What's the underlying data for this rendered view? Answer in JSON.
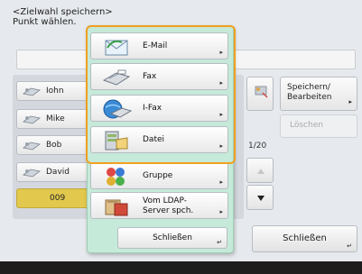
{
  "header": {
    "line1": "<Zielwahl speichern>",
    "line2": "Punkt wählen."
  },
  "addresses": [
    {
      "label": "Iohn"
    },
    {
      "label": "Mike"
    },
    {
      "label": "Bob"
    },
    {
      "label": "David"
    },
    {
      "label": "009"
    }
  ],
  "page_indicator": "1/20",
  "right_buttons": {
    "store": "Speichern/\nBearbeiten",
    "store_line1": "Speichern/",
    "store_line2": "Bearbeiten",
    "delete": "Löschen"
  },
  "main_close": "Schließen",
  "popup": {
    "items": [
      {
        "label": "E-Mail",
        "icon": "email-icon"
      },
      {
        "label": "Fax",
        "icon": "fax-icon"
      },
      {
        "label": "I-Fax",
        "icon": "ifax-icon"
      },
      {
        "label": "Datei",
        "icon": "file-server-icon"
      },
      {
        "label": "Gruppe",
        "icon": "group-icon"
      },
      {
        "label_line1": "Vom LDAP-",
        "label_line2": "Server spch.",
        "icon": "ldap-server-icon"
      }
    ],
    "close": "Schließen"
  },
  "colors": {
    "popup_bg": "#c6ead9",
    "highlight": "#f0a020",
    "selected_row": "#e2c84c"
  }
}
